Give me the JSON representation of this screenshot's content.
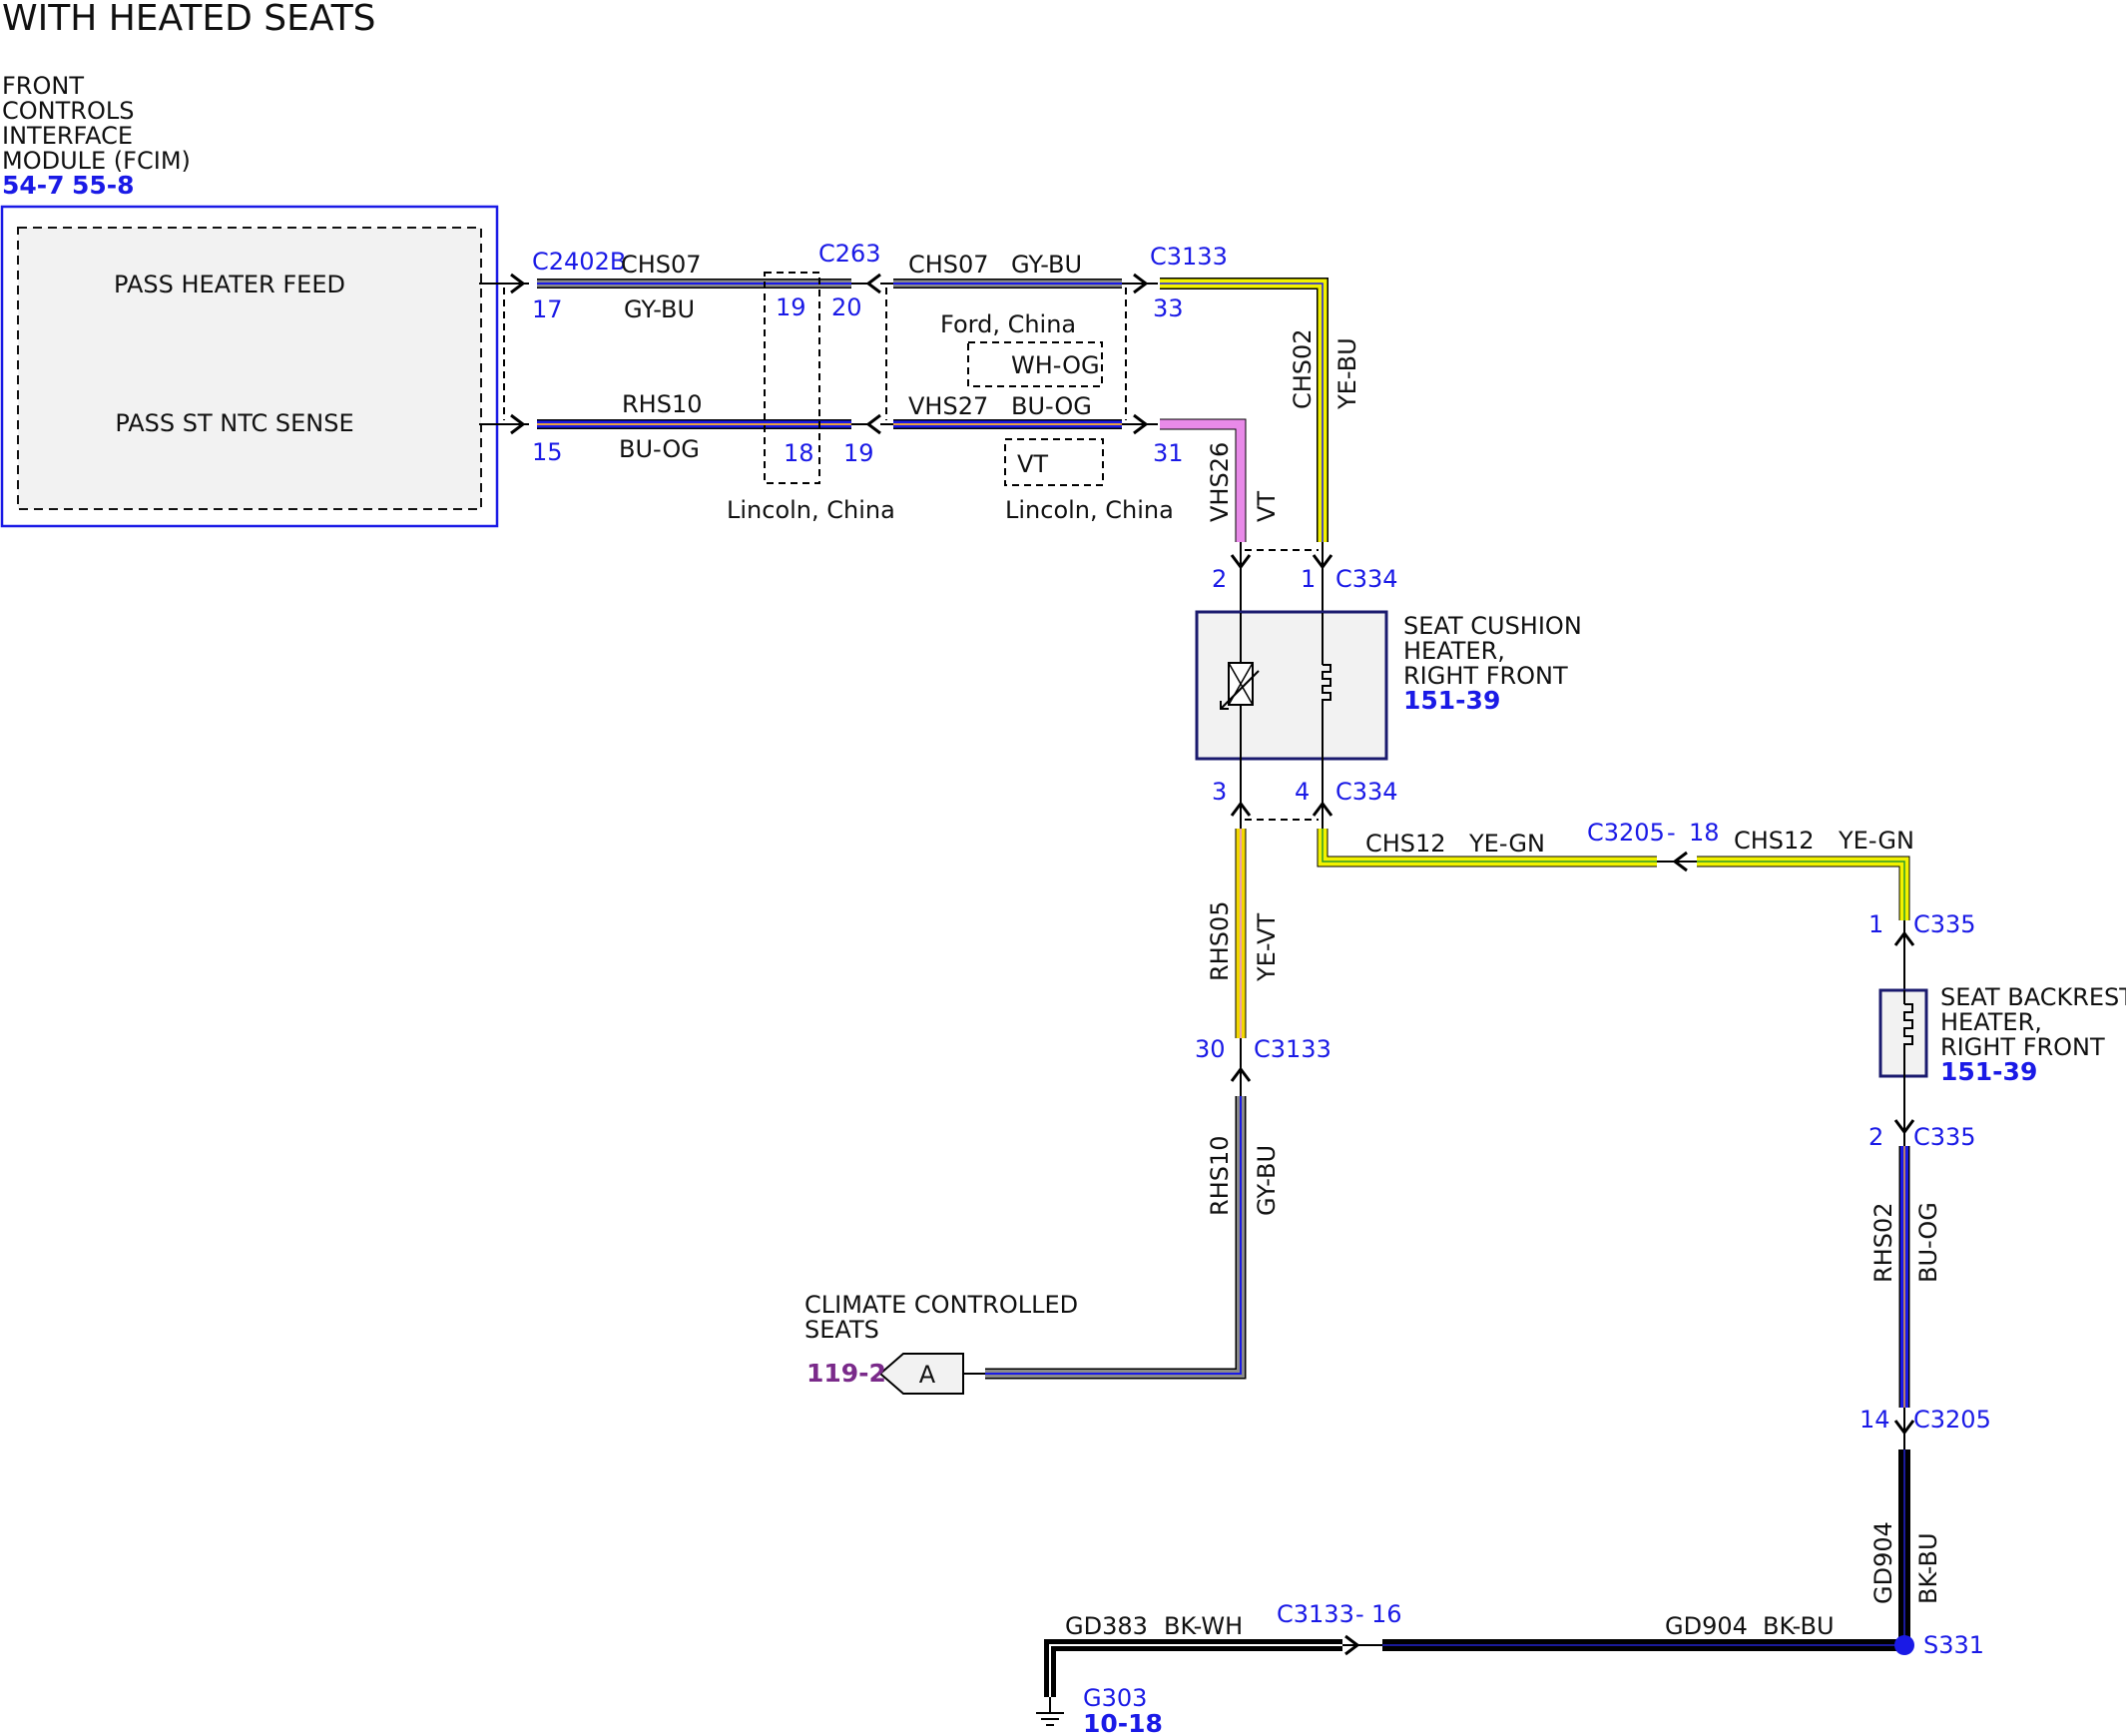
{
  "title": "WITH HEATED SEATS",
  "colors": {
    "blue": "#1a1ae6",
    "purple": "#7a2a8a",
    "gray": "#8a8a8a",
    "yellow": "#f2f200",
    "violet": "#e88ae8",
    "black": "#000000",
    "navy": "#1a1a6e",
    "box_fill": "#f2f2f2"
  },
  "fcim": {
    "name_lines": [
      "FRONT",
      "CONTROLS",
      "INTERFACE",
      "MODULE (FCIM)"
    ],
    "refs": [
      "54-7",
      "55-8"
    ],
    "pass_heater_feed": "PASS HEATER FEED",
    "pass_st_ntc_sense": "PASS ST NTC SENSE"
  },
  "wires": {
    "top_left": {
      "connector": "C2402B",
      "circuit": "CHS07",
      "color": "GY-BU",
      "pin": "17"
    },
    "bot_left": {
      "circuit": "RHS10",
      "color": "BU-OG",
      "pin": "15"
    },
    "inline_c263": {
      "connector": "C263",
      "top_left_pin": "19",
      "top_right_pin": "20",
      "bot_left_pin": "18",
      "bot_right_pin": "19",
      "note": "Lincoln, China"
    },
    "top_mid": {
      "circuit": "CHS07",
      "color": "GY-BU",
      "alt_note": "Ford, China",
      "alt_color": "WH-OG"
    },
    "bot_mid": {
      "circuit": "VHS27",
      "color": "BU-OG",
      "alt_color": "VT",
      "note": "Lincoln, China"
    },
    "c3133_top": {
      "connector": "C3133",
      "pin_top": "33",
      "pin_bot": "31"
    },
    "chs02": {
      "circuit": "CHS02",
      "color": "YE-BU"
    },
    "vhs26": {
      "circuit": "VHS26",
      "color": "VT"
    },
    "rhs05": {
      "circuit": "RHS05",
      "color": "YE-VT"
    },
    "c3133_mid": {
      "pin": "30",
      "connector": "C3133"
    },
    "rhs10_low": {
      "circuit": "RHS10",
      "color": "GY-BU"
    },
    "chs12_left": {
      "circuit": "CHS12",
      "color": "YE-GN"
    },
    "c3205_top": {
      "connector": "C3205",
      "dash": "-",
      "pin": "18"
    },
    "chs12_right": {
      "circuit": "CHS12",
      "color": "YE-GN"
    },
    "rhs02": {
      "circuit": "RHS02",
      "color": "BU-OG"
    },
    "c3205_bot": {
      "pin": "14",
      "connector": "C3205"
    },
    "gd904_v": {
      "circuit": "GD904",
      "color": "BK-BU"
    },
    "gd383": {
      "circuit": "GD383",
      "color": "BK-WH"
    },
    "c3133_bot": {
      "connector": "C3133",
      "dash": "-",
      "pin": "16"
    },
    "gd904_h": {
      "circuit": "GD904",
      "color": "BK-BU"
    }
  },
  "cushion": {
    "connector_top": "C334",
    "pin_tl": "2",
    "pin_tr": "1",
    "connector_bot": "C334",
    "pin_bl": "3",
    "pin_br": "4",
    "name_lines": [
      "SEAT CUSHION",
      "HEATER,",
      "RIGHT FRONT"
    ],
    "ref": "151-39"
  },
  "backrest": {
    "connector_top": "C335",
    "pin_top": "1",
    "connector_bot": "C335",
    "pin_bot": "2",
    "name_lines": [
      "SEAT BACKREST",
      "HEATER,",
      "RIGHT FRONT"
    ],
    "ref": "151-39"
  },
  "splice": {
    "name": "S331"
  },
  "ground": {
    "name": "G303",
    "ref": "10-18"
  },
  "climate": {
    "name_lines": [
      "CLIMATE CONTROLLED",
      "SEATS"
    ],
    "ref": "119-2",
    "tag": "A"
  }
}
